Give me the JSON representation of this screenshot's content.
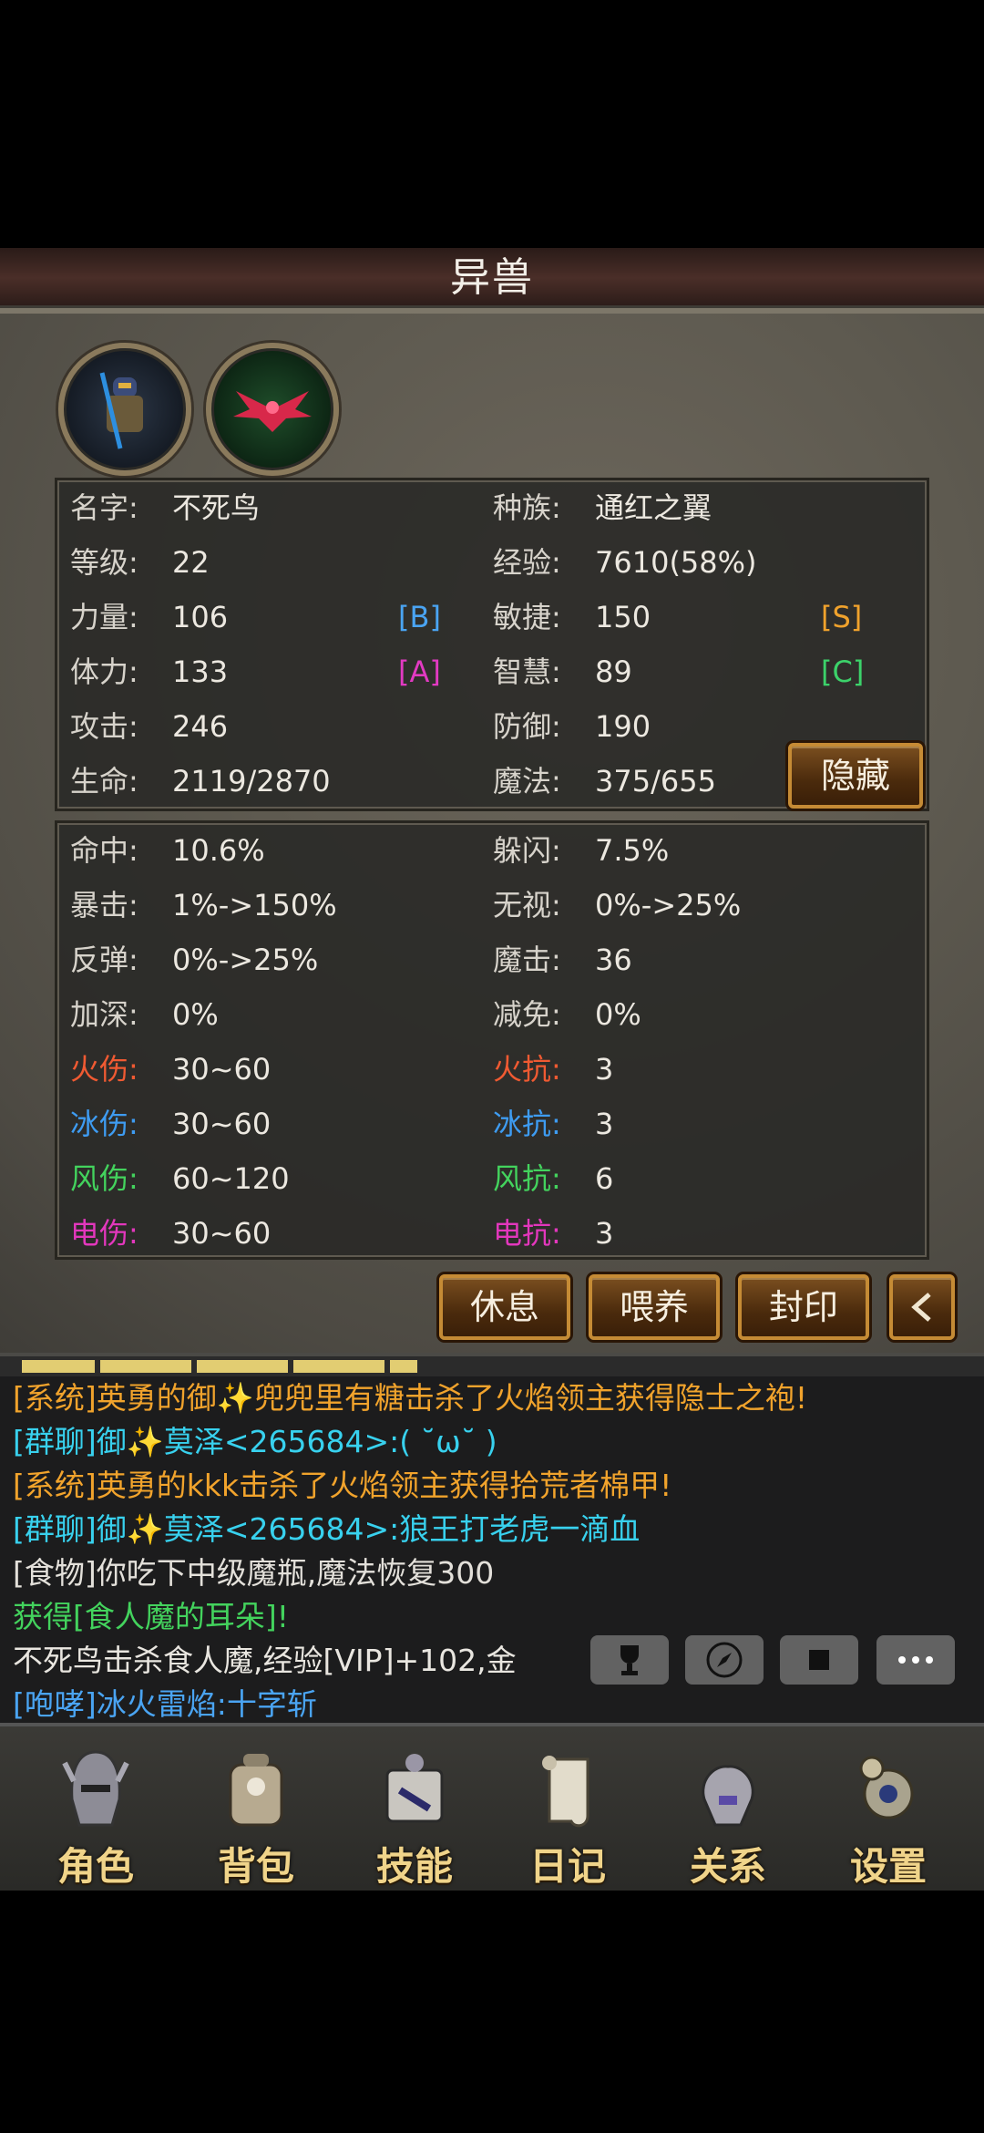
{
  "header": {
    "title": "异兽"
  },
  "pet": {
    "name_label": "名字:",
    "name": "不死鸟",
    "race_label": "种族:",
    "race": "通红之翼",
    "level_label": "等级:",
    "level": "22",
    "exp_label": "经验:",
    "exp": "7610(58%)",
    "str_label": "力量:",
    "str": "106",
    "str_grade": "[B]",
    "agi_label": "敏捷:",
    "agi": "150",
    "agi_grade": "[S]",
    "vit_label": "体力:",
    "vit": "133",
    "vit_grade": "[A]",
    "int_label": "智慧:",
    "int": "89",
    "int_grade": "[C]",
    "atk_label": "攻击:",
    "atk": "246",
    "def_label": "防御:",
    "def": "190",
    "hp_label": "生命:",
    "hp": "2119/2870",
    "mp_label": "魔法:",
    "mp": "375/655",
    "hide_button": "隐藏"
  },
  "stats": [
    {
      "l1": "命中:",
      "v1": "10.6%",
      "l2": "躲闪:",
      "v2": "7.5%"
    },
    {
      "l1": "暴击:",
      "v1": "1%->150%",
      "l2": "无视:",
      "v2": "0%->25%"
    },
    {
      "l1": "反弹:",
      "v1": "0%->25%",
      "l2": "魔击:",
      "v2": "36"
    },
    {
      "l1": "加深:",
      "v1": "0%",
      "l2": "减免:",
      "v2": "0%"
    },
    {
      "l1": "火伤:",
      "v1": "30~60",
      "l2": "火抗:",
      "v2": "3"
    },
    {
      "l1": "冰伤:",
      "v1": "30~60",
      "l2": "冰抗:",
      "v2": "3"
    },
    {
      "l1": "风伤:",
      "v1": "60~120",
      "l2": "风抗:",
      "v2": "6"
    },
    {
      "l1": "电伤:",
      "v1": "30~60",
      "l2": "电抗:",
      "v2": "3"
    }
  ],
  "actions": {
    "rest": "休息",
    "feed": "喂养",
    "seal": "封印",
    "back_icon": "chevron-left-icon"
  },
  "chat": [
    "[系统]英勇的御✨兜兜里有糖击杀了火焰领主获得隐士之袍!",
    "[群聊]御✨莫泽<265684>:( ˘ω˘ )",
    "[系统]英勇的kkk击杀了火焰领主获得拾荒者棉甲!",
    "[群聊]御✨莫泽<265684>:狼王打老虎一滴血",
    "[食物]你吃下中级魔瓶,魔法恢复300",
    "获得[食人魔的耳朵]!",
    "不死鸟击杀食人魔,经验[VIP]+102,金",
    "[咆哮]冰火雷焰:十字斩"
  ],
  "chat_icons": [
    "trophy-icon",
    "compass-icon",
    "stop-icon",
    "more-icon"
  ],
  "nav": [
    {
      "label": "角色",
      "icon": "helmet-icon"
    },
    {
      "label": "背包",
      "icon": "backpack-icon"
    },
    {
      "label": "技能",
      "icon": "skillbook-icon"
    },
    {
      "label": "日记",
      "icon": "scroll-icon"
    },
    {
      "label": "关系",
      "icon": "gauntlet-icon"
    },
    {
      "label": "设置",
      "icon": "gear-icon"
    }
  ]
}
